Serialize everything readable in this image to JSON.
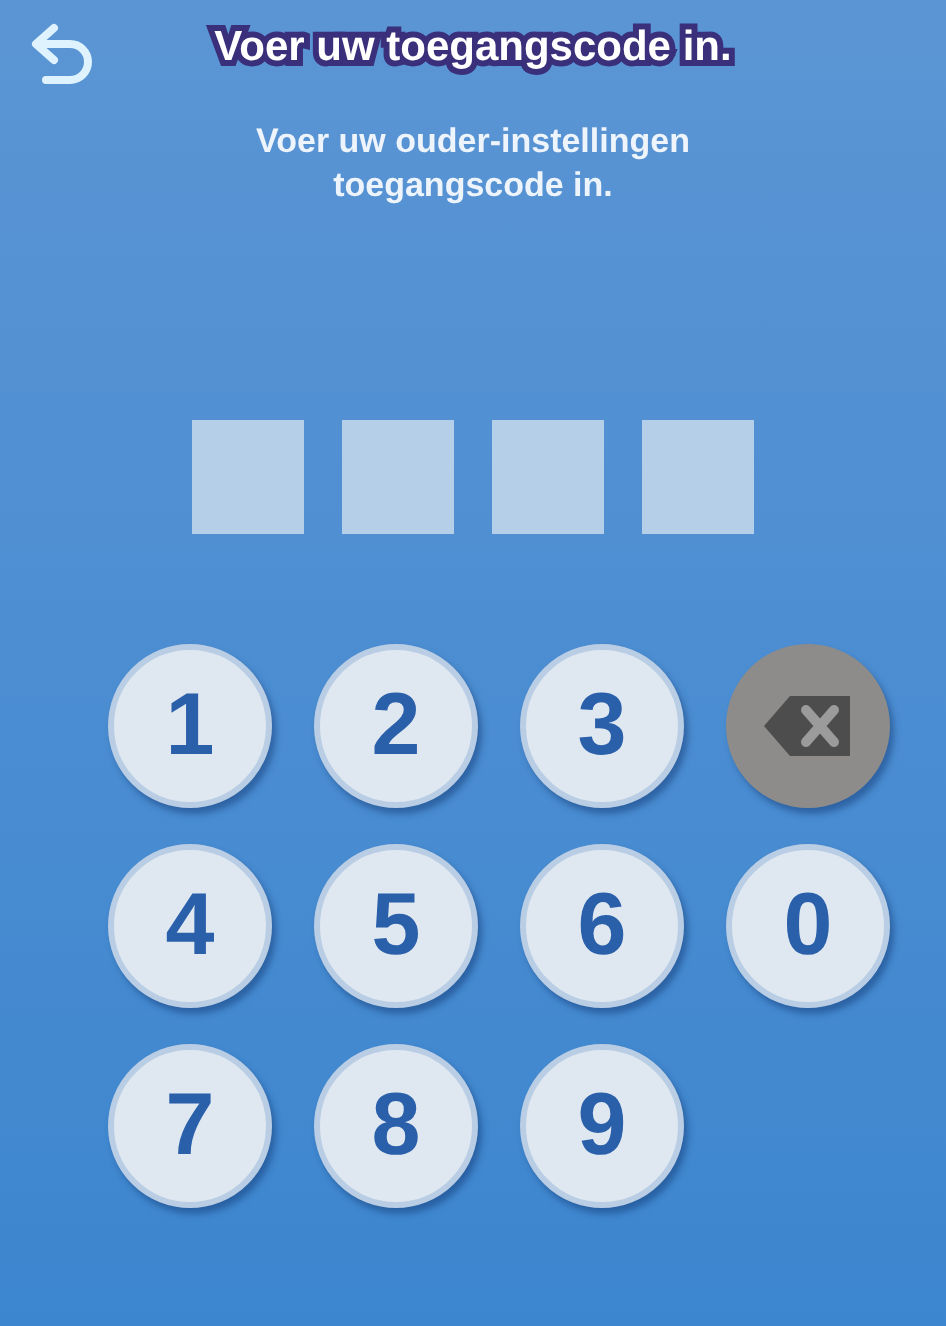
{
  "header": {
    "title": "Voer uw toegangscode in."
  },
  "instruction": "Voer uw ouder-instellingen toegangscode in.",
  "code_boxes": [
    {
      "filled": false
    },
    {
      "filled": false
    },
    {
      "filled": false
    },
    {
      "filled": false
    }
  ],
  "keypad": [
    {
      "kind": "digit",
      "label": "1"
    },
    {
      "kind": "digit",
      "label": "2"
    },
    {
      "kind": "digit",
      "label": "3"
    },
    {
      "kind": "backspace",
      "disabled": true
    },
    {
      "kind": "digit",
      "label": "4"
    },
    {
      "kind": "digit",
      "label": "5"
    },
    {
      "kind": "digit",
      "label": "6"
    },
    {
      "kind": "digit",
      "label": "0"
    },
    {
      "kind": "digit",
      "label": "7"
    },
    {
      "kind": "digit",
      "label": "8"
    },
    {
      "kind": "digit",
      "label": "9"
    }
  ]
}
